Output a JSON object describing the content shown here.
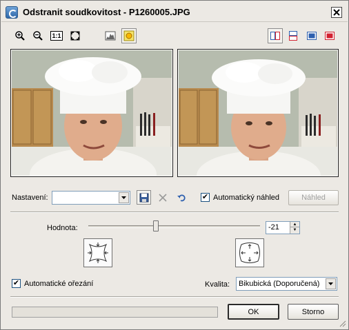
{
  "window": {
    "title": "Odstranit soudkovitost - P1260005.JPG"
  },
  "toolbar": {
    "left_tools": [
      {
        "icon": "zoom-in-icon"
      },
      {
        "icon": "zoom-out-icon"
      },
      {
        "icon": "actual-size-icon",
        "text": "1:1"
      },
      {
        "icon": "fit-to-window-icon"
      },
      {
        "icon": "histogram-icon"
      },
      {
        "icon": "brightness-icon"
      }
    ],
    "right_tools": [
      {
        "icon": "split-vertical-icon"
      },
      {
        "icon": "split-horizontal-icon"
      },
      {
        "icon": "before-view-icon"
      },
      {
        "icon": "after-view-icon"
      }
    ]
  },
  "settings": {
    "label": "Nastavení:",
    "value": "",
    "auto_preview_label": "Automatický náhled",
    "auto_preview_checked": true,
    "preview_button": "Náhled"
  },
  "value": {
    "label": "Hodnota:",
    "number": "-21",
    "slider_min": -100,
    "slider_max": 100
  },
  "options": {
    "auto_crop_label": "Automatické ořezání",
    "auto_crop_checked": true,
    "quality_label": "Kvalita:",
    "quality_value": "Bikubická (Doporučená)"
  },
  "buttons": {
    "ok": "OK",
    "cancel": "Storno"
  },
  "progress": {
    "fraction": 0
  },
  "colors": {
    "window_bg": "#ece9e4",
    "accent_red": "#d22030",
    "accent_blue": "#2d5fae"
  }
}
